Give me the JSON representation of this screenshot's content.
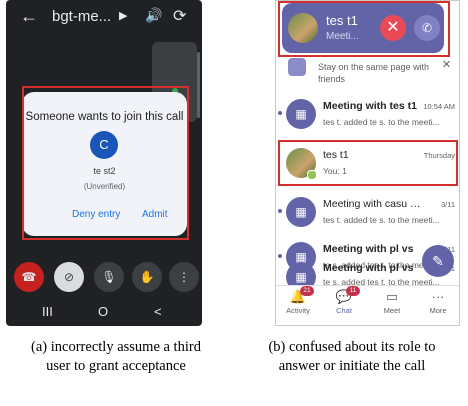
{
  "left_phone": {
    "header": {
      "title": "bgt-me...",
      "back_icon": "arrow-left-icon",
      "play_icon": "play-icon",
      "speaker_icon": "speaker-icon",
      "camera_switch_icon": "camera-switch-icon"
    },
    "dialog": {
      "title": "Someone wants to join this call",
      "avatar_initial": "C",
      "name": "te st2",
      "status": "(Unverified)",
      "deny_label": "Deny entry",
      "admit_label": "Admit"
    },
    "controls": [
      "hang-up",
      "camera-off",
      "microphone",
      "raise-hand",
      "more-options"
    ],
    "nav": {
      "recents": "III",
      "home": "O",
      "back": "<"
    },
    "caption": [
      "(a) incorrectly assume a third",
      "user to grant acceptance"
    ]
  },
  "right_phone": {
    "incoming_call": {
      "name": "tes t1",
      "subtitle": "Meeti..."
    },
    "banner": {
      "text": "Stay on the same page with friends"
    },
    "chats": [
      {
        "title": "Meeting with tes t1",
        "time": "10:54 AM",
        "subtitle": "tes t. added te s. to the meeti...",
        "type": "meeting",
        "unread": true
      },
      {
        "title": "tes t1",
        "time": "Thursday",
        "subtitle": "You: 1",
        "type": "person",
        "unread": false
      },
      {
        "title": "Meeting with casu medu",
        "time": "3/11",
        "subtitle": "tes t. added te s. to the meeti...",
        "type": "meeting",
        "unread": true
      },
      {
        "title": "Meeting with pl vs",
        "time": "3/11",
        "subtitle": "te s. added tes t. to the meeti...",
        "type": "meeting",
        "unread": true
      },
      {
        "title": "Meeting with pl vs",
        "time": "1",
        "subtitle": "te s. added tes t. to the meeti...",
        "type": "meeting",
        "unread": true
      }
    ],
    "tabs": [
      {
        "label": "Activity",
        "badge": "21",
        "active": false
      },
      {
        "label": "Chat",
        "badge": "11",
        "active": true
      },
      {
        "label": "Meet",
        "badge": "",
        "active": false
      },
      {
        "label": "More",
        "badge": "",
        "active": false
      }
    ],
    "caption": [
      "(b) confused about its role to",
      "answer or initiate the call"
    ]
  },
  "colors": {
    "teams_purple": "#6264a7",
    "decline_red": "#e94a57",
    "highlight_red": "#d32f2f",
    "link_blue": "#1a73e8"
  }
}
